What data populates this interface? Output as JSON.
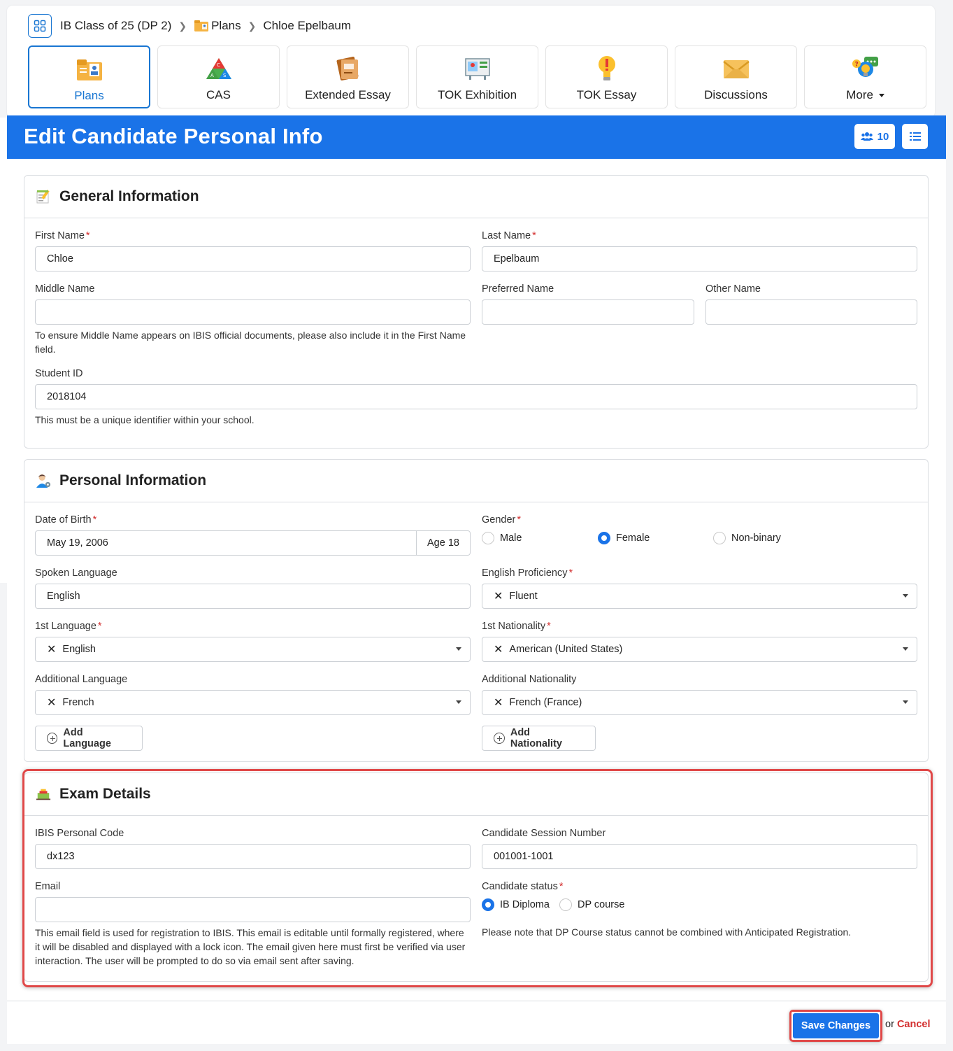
{
  "breadcrumb": {
    "class": "IB Class of 25 (DP 2)",
    "plans": "Plans",
    "student": "Chloe Epelbaum"
  },
  "tabs": [
    {
      "label": "Plans",
      "icon": "plans-folder-icon",
      "active": true
    },
    {
      "label": "CAS",
      "icon": "cas-triangle-icon"
    },
    {
      "label": "Extended Essay",
      "icon": "extended-essay-book-icon"
    },
    {
      "label": "TOK Exhibition",
      "icon": "tok-exhibition-easel-icon"
    },
    {
      "label": "TOK Essay",
      "icon": "tok-essay-lightbulb-icon"
    },
    {
      "label": "Discussions",
      "icon": "discussions-envelope-icon"
    },
    {
      "label": "More",
      "icon": "more-chat-icon"
    }
  ],
  "header": {
    "title": "Edit Candidate Personal Info",
    "member_count": "10"
  },
  "general": {
    "title": "General Information",
    "first_name_label": "First Name",
    "first_name": "Chloe",
    "last_name_label": "Last Name",
    "last_name": "Epelbaum",
    "middle_name_label": "Middle Name",
    "middle_name": "",
    "preferred_name_label": "Preferred Name",
    "preferred_name": "",
    "other_name_label": "Other Name",
    "other_name": "",
    "middle_help": "To ensure Middle Name appears on IBIS official documents, please also include it in the First Name field.",
    "student_id_label": "Student ID",
    "student_id": "2018104",
    "student_id_help": "This must be a unique identifier within your school."
  },
  "personal": {
    "title": "Personal Information",
    "dob_label": "Date of Birth",
    "dob": "May 19, 2006",
    "age": "Age 18",
    "gender_label": "Gender",
    "gender_options": [
      "Male",
      "Female",
      "Non-binary"
    ],
    "gender_selected": "Female",
    "spoken_language_label": "Spoken Language",
    "spoken_language": "English",
    "english_prof_label": "English Proficiency",
    "english_prof": "Fluent",
    "first_language_label": "1st Language",
    "first_language": "English",
    "first_nationality_label": "1st Nationality",
    "first_nationality": "American (United States)",
    "add_language_label": "Additional Language",
    "add_language": "French",
    "add_nationality_label": "Additional Nationality",
    "add_nationality": "French (France)",
    "add_language_btn": "Add Language",
    "add_nationality_btn": "Add Nationality"
  },
  "exam": {
    "title": "Exam Details",
    "ibis_code_label": "IBIS Personal Code",
    "ibis_code": "dx123",
    "session_label": "Candidate Session Number",
    "session": "001001-1001",
    "email_label": "Email",
    "email": "",
    "email_help": "This email field is used for registration to IBIS. This email is editable until formally registered, where it will be disabled and displayed with a lock icon. The email given here must first be verified via user interaction. The user will be prompted to do so via email sent after saving.",
    "status_label": "Candidate status",
    "status_options": [
      "IB Diploma",
      "DP course"
    ],
    "status_selected": "IB Diploma",
    "status_help": "Please note that DP Course status cannot be combined with Anticipated Registration."
  },
  "footer": {
    "save": "Save Changes",
    "or": "or",
    "cancel": "Cancel"
  },
  "colors": {
    "primary": "#1a73e8",
    "required": "#d32f2f",
    "highlight": "#e04848"
  }
}
